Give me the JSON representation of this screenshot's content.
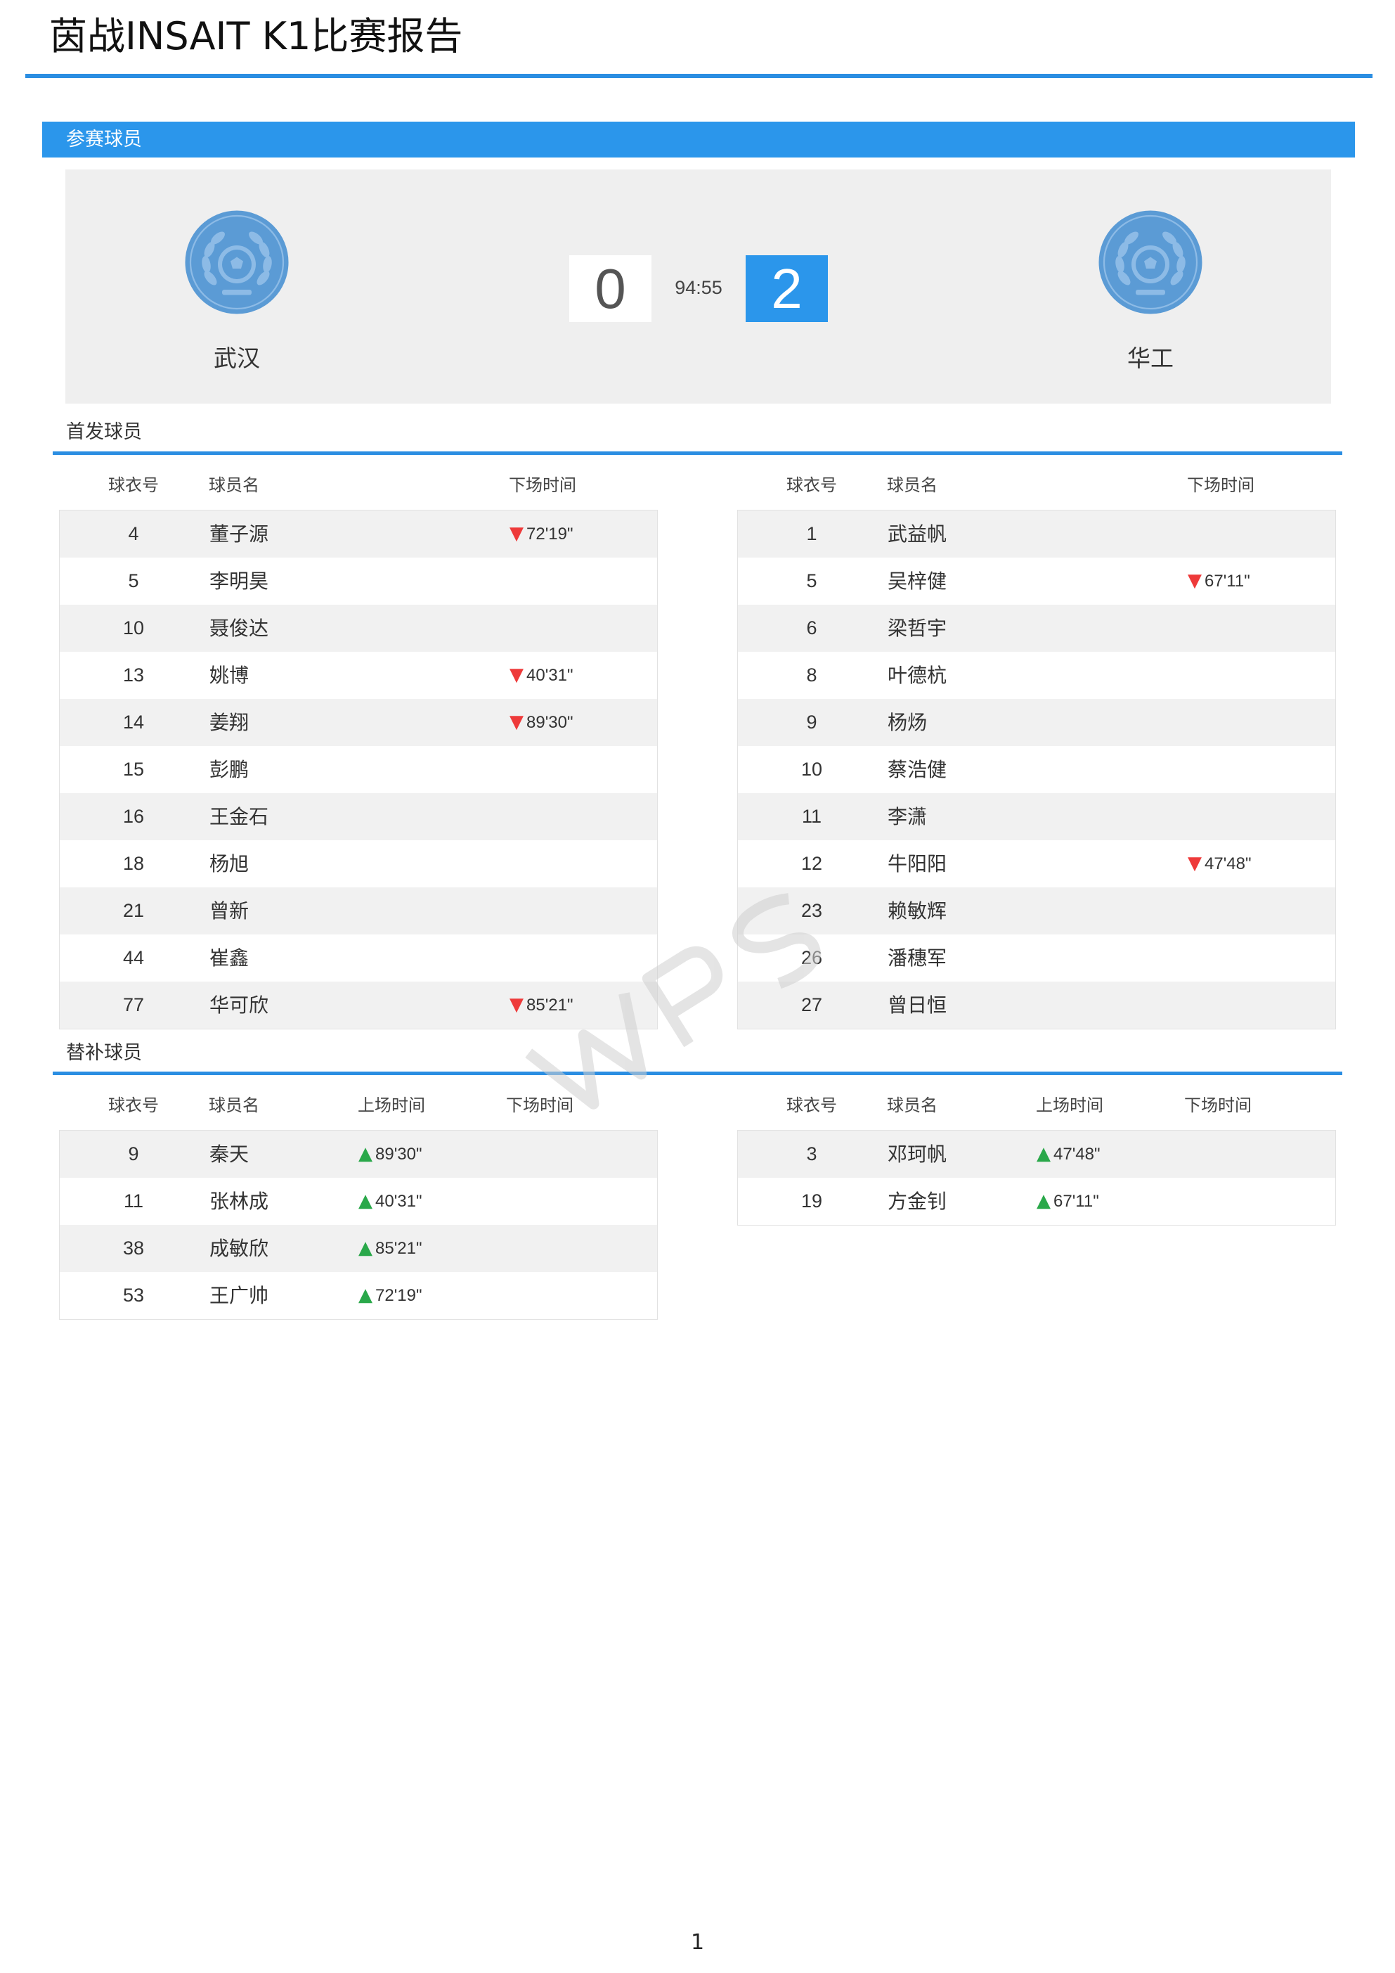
{
  "report": {
    "title": "茵战INSAIT K1比赛报告"
  },
  "section": {
    "title": "参赛球员"
  },
  "match": {
    "home_team": "武汉",
    "away_team": "华工",
    "home_score": "0",
    "away_score": "2",
    "time": "94:55"
  },
  "starters": {
    "title": "首发球员",
    "headers": {
      "number": "球衣号",
      "name": "球员名",
      "off": "下场时间"
    },
    "home": [
      {
        "number": "4",
        "name": "董子源",
        "off": "72'19\""
      },
      {
        "number": "5",
        "name": "李明昊",
        "off": ""
      },
      {
        "number": "10",
        "name": "聂俊达",
        "off": ""
      },
      {
        "number": "13",
        "name": "姚博",
        "off": "40'31\""
      },
      {
        "number": "14",
        "name": "姜翔",
        "off": "89'30\""
      },
      {
        "number": "15",
        "name": "彭鹏",
        "off": ""
      },
      {
        "number": "16",
        "name": "王金石",
        "off": ""
      },
      {
        "number": "18",
        "name": "杨旭",
        "off": ""
      },
      {
        "number": "21",
        "name": "曾新",
        "off": ""
      },
      {
        "number": "44",
        "name": "崔鑫",
        "off": ""
      },
      {
        "number": "77",
        "name": "华可欣",
        "off": "85'21\""
      }
    ],
    "away": [
      {
        "number": "1",
        "name": "武益帆",
        "off": ""
      },
      {
        "number": "5",
        "name": "吴梓健",
        "off": "67'11\""
      },
      {
        "number": "6",
        "name": "梁哲宇",
        "off": ""
      },
      {
        "number": "8",
        "name": "叶德杭",
        "off": ""
      },
      {
        "number": "9",
        "name": "杨炀",
        "off": ""
      },
      {
        "number": "10",
        "name": "蔡浩健",
        "off": ""
      },
      {
        "number": "11",
        "name": "李潇",
        "off": ""
      },
      {
        "number": "12",
        "name": "牛阳阳",
        "off": "47'48\""
      },
      {
        "number": "23",
        "name": "赖敏辉",
        "off": ""
      },
      {
        "number": "26",
        "name": "潘穗军",
        "off": ""
      },
      {
        "number": "27",
        "name": "曾日恒",
        "off": ""
      }
    ]
  },
  "substitutes": {
    "title": "替补球员",
    "headers": {
      "number": "球衣号",
      "name": "球员名",
      "on": "上场时间",
      "off": "下场时间"
    },
    "home": [
      {
        "number": "9",
        "name": "秦天",
        "on": "89'30\"",
        "off": ""
      },
      {
        "number": "11",
        "name": "张林成",
        "on": "40'31\"",
        "off": ""
      },
      {
        "number": "38",
        "name": "成敏欣",
        "on": "85'21\"",
        "off": ""
      },
      {
        "number": "53",
        "name": "王广帅",
        "on": "72'19\"",
        "off": ""
      }
    ],
    "away": [
      {
        "number": "3",
        "name": "邓珂帆",
        "on": "47'48\"",
        "off": ""
      },
      {
        "number": "19",
        "name": "方金钊",
        "on": "67'11\"",
        "off": ""
      }
    ]
  },
  "icons": {
    "team_logo": "soccer-laurel-badge-icon",
    "sub_off": "red-down-triangle-icon",
    "sub_on": "green-up-triangle-icon"
  },
  "colors": {
    "accent": "#2b96eb",
    "sub_off": "#ee3a3a",
    "sub_on": "#2aa84a",
    "logo": "#5b9bd5"
  },
  "footer": {
    "page_number": "1"
  }
}
